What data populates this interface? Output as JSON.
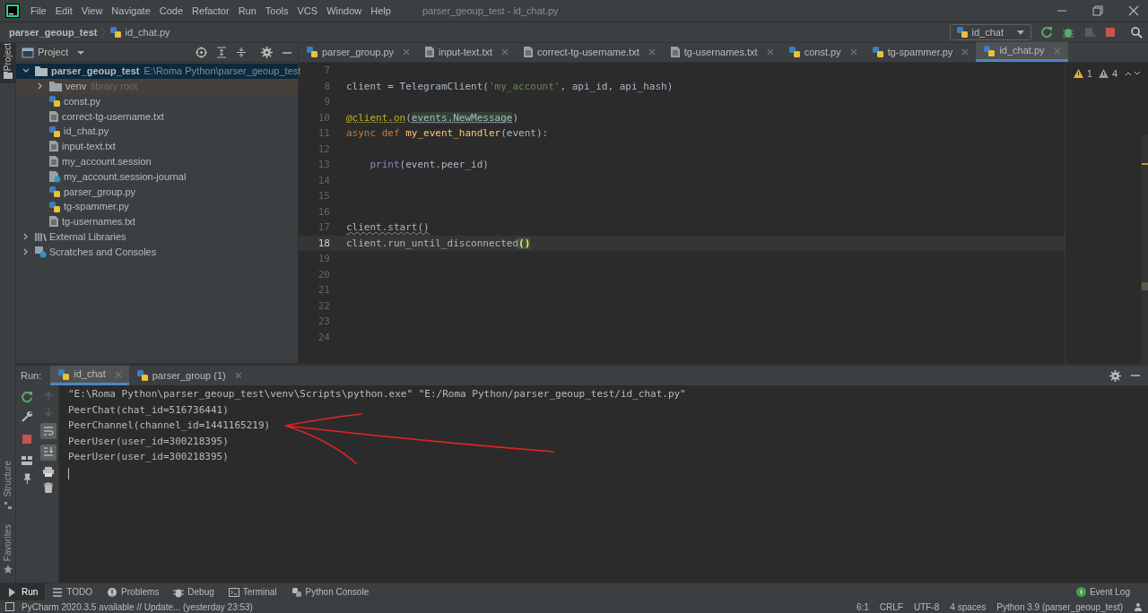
{
  "menu_bar": {
    "items": [
      "File",
      "Edit",
      "View",
      "Navigate",
      "Code",
      "Refactor",
      "Run",
      "Tools",
      "VCS",
      "Window",
      "Help"
    ],
    "title": "parser_geoup_test - id_chat.py"
  },
  "nav_bar": {
    "breadcrumbs": [
      "parser_geoup_test",
      "id_chat.py"
    ],
    "run_config": "id_chat"
  },
  "project": {
    "title": "Project",
    "tree": [
      {
        "label": "parser_geoup_test",
        "hint": "E:\\Roma Python\\parser_geoup_test",
        "kind": "folder",
        "expanded": true,
        "selected": true,
        "children": [
          {
            "label": "venv",
            "hint": "library root",
            "kind": "library",
            "expanded": false,
            "selected": false
          },
          {
            "label": "const.py",
            "kind": "python",
            "selected": false
          },
          {
            "label": "correct-tg-username.txt",
            "kind": "text",
            "selected": false
          },
          {
            "label": "id_chat.py",
            "kind": "python",
            "selected": false
          },
          {
            "label": "input-text.txt",
            "kind": "text",
            "selected": false
          },
          {
            "label": "my_account.session",
            "kind": "text",
            "selected": false
          },
          {
            "label": "my_account.session-journal",
            "kind": "unknown",
            "selected": false
          },
          {
            "label": "parser_group.py",
            "kind": "python",
            "selected": false
          },
          {
            "label": "tg-spammer.py",
            "kind": "python",
            "selected": false
          },
          {
            "label": "tg-usernames.txt",
            "kind": "text",
            "selected": false
          }
        ]
      },
      {
        "label": "External Libraries",
        "kind": "libraries",
        "expanded": false,
        "selected": false
      },
      {
        "label": "Scratches and Consoles",
        "kind": "scratches",
        "expanded": false,
        "selected": false
      }
    ]
  },
  "editor": {
    "tabs": [
      {
        "label": "parser_group.py",
        "kind": "python",
        "selected": false
      },
      {
        "label": "input-text.txt",
        "kind": "text",
        "selected": false
      },
      {
        "label": "correct-tg-username.txt",
        "kind": "text",
        "selected": false
      },
      {
        "label": "tg-usernames.txt",
        "kind": "text",
        "selected": false
      },
      {
        "label": "const.py",
        "kind": "python",
        "selected": false
      },
      {
        "label": "tg-spammer.py",
        "kind": "python",
        "selected": false
      },
      {
        "label": "id_chat.py",
        "kind": "python",
        "selected": true
      }
    ],
    "warnings": [
      "1",
      "4"
    ],
    "lines": [
      {
        "number": "7",
        "current": false
      },
      {
        "number": "8",
        "current": false,
        "tokens": [
          {
            "text": "client = TelegramClient(",
            "kind": "plain"
          },
          {
            "text": "'my_account'",
            "kind": "string"
          },
          {
            "text": ", api_id, api_hash)",
            "kind": "plain"
          }
        ]
      },
      {
        "number": "9",
        "current": false
      },
      {
        "number": "10",
        "current": false,
        "tokens": [
          {
            "text": "@client.on",
            "kind": "decorator"
          },
          {
            "text": "(",
            "kind": "plain"
          },
          {
            "text": "events.NewMessage",
            "kind": "usage"
          },
          {
            "text": ")",
            "kind": "plain"
          }
        ]
      },
      {
        "number": "11",
        "current": false,
        "tokens": [
          {
            "text": "async def ",
            "kind": "keyword"
          },
          {
            "text": "my_event_handler",
            "kind": "funcdef"
          },
          {
            "text": "(event):",
            "kind": "plain"
          }
        ]
      },
      {
        "number": "12",
        "current": false
      },
      {
        "number": "13",
        "current": false,
        "tokens": [
          {
            "text": "    print",
            "kind": "builtin"
          },
          {
            "text": "(event.peer_id)",
            "kind": "plain"
          }
        ]
      },
      {
        "number": "14",
        "current": false
      },
      {
        "number": "15",
        "current": false
      },
      {
        "number": "16",
        "current": false
      },
      {
        "number": "17",
        "current": false,
        "tokens": [
          {
            "text": "client.start()",
            "kind": "warning"
          }
        ]
      },
      {
        "number": "18",
        "current": true,
        "tokens": [
          {
            "text": "client.run_until_disconnected",
            "kind": "plain"
          },
          {
            "text": "()",
            "kind": "match"
          }
        ]
      },
      {
        "number": "19",
        "current": false
      },
      {
        "number": "20",
        "current": false
      },
      {
        "number": "21",
        "current": false
      },
      {
        "number": "22",
        "current": false
      },
      {
        "number": "23",
        "current": false
      },
      {
        "number": "24",
        "current": false
      }
    ]
  },
  "run_panel": {
    "label": "Run:",
    "tabs": [
      {
        "label": "id_chat",
        "selected": true
      },
      {
        "label": "parser_group (1)",
        "selected": false
      }
    ],
    "output": [
      "\"E:\\Roma Python\\parser_geoup_test\\venv\\Scripts\\python.exe\" \"E:/Roma Python/parser_geoup_test/id_chat.py\"",
      "PeerChat(chat_id=516736441)",
      "PeerChannel(channel_id=1441165219)",
      "PeerUser(user_id=300218395)",
      "PeerUser(user_id=300218395)"
    ]
  },
  "side_strip": [
    "Project",
    "Structure",
    "Favorites"
  ],
  "tool_windows": [
    {
      "label": "Run",
      "kind": "run",
      "selected": true
    },
    {
      "label": "TODO",
      "kind": "todo",
      "selected": false
    },
    {
      "label": "Problems",
      "kind": "problems",
      "selected": false
    },
    {
      "label": "Debug",
      "kind": "debug",
      "selected": false
    },
    {
      "label": "Terminal",
      "kind": "terminal",
      "selected": false
    },
    {
      "label": "Python Console",
      "kind": "console",
      "selected": false
    }
  ],
  "event_log": "Event Log",
  "status_bar": {
    "message": "PyCharm 2020.3.5 available // Update... (yesterday 23:53)",
    "items": [
      "6:1",
      "CRLF",
      "UTF-8",
      "4 spaces",
      "Python 3.9 (parser_geoup_test)"
    ]
  }
}
